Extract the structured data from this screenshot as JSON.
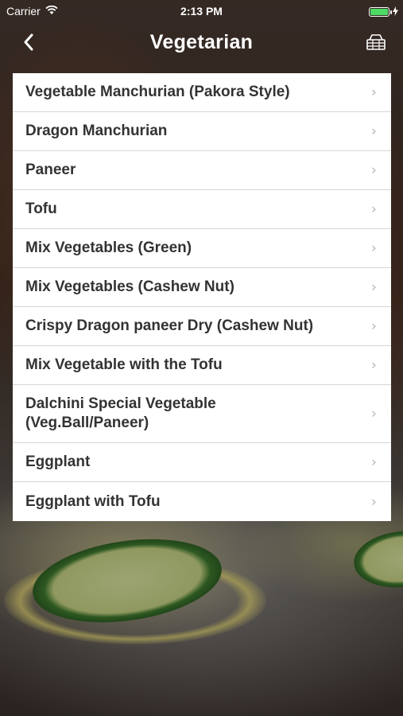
{
  "status_bar": {
    "carrier": "Carrier",
    "time": "2:13 PM"
  },
  "nav": {
    "title": "Vegetarian",
    "back_icon": "chevron-left-icon",
    "cart_icon": "cart-icon"
  },
  "menu": {
    "items": [
      {
        "label": "Vegetable Manchurian (Pakora Style)"
      },
      {
        "label": "Dragon Manchurian"
      },
      {
        "label": "Paneer"
      },
      {
        "label": "Tofu"
      },
      {
        "label": "Mix Vegetables (Green)"
      },
      {
        "label": "Mix Vegetables (Cashew Nut)"
      },
      {
        "label": "Crispy Dragon paneer Dry (Cashew Nut)"
      },
      {
        "label": "Mix Vegetable with the Tofu"
      },
      {
        "label": "Dalchini Special Vegetable (Veg.Ball/Paneer)"
      },
      {
        "label": "Eggplant"
      },
      {
        "label": "Eggplant with Tofu"
      }
    ]
  },
  "colors": {
    "battery": "#4cd964",
    "row_text": "#333333",
    "chevron": "#b8b8b8"
  }
}
